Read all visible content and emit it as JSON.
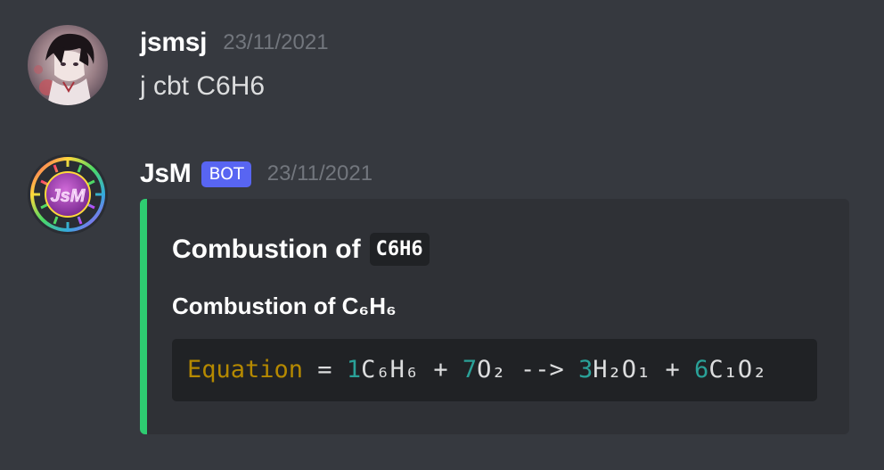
{
  "messages": [
    {
      "author": "jsmsj",
      "timestamp": "23/11/2021",
      "content": "j cbt C6H6"
    },
    {
      "author": "JsM",
      "bot_tag": "BOT",
      "timestamp": "23/11/2021",
      "avatar_text": "JsM",
      "embed": {
        "accent_color": "#2ecc71",
        "title_text": "Combustion of",
        "title_code": "C6H6",
        "field_name": "Combustion of C₆H₆",
        "equation": {
          "label": "Equation",
          "eq": " = ",
          "terms": [
            {
              "coef": "1",
              "formula": "C₆H₆"
            },
            {
              "coef": "7",
              "formula": "O₂"
            },
            {
              "coef": "3",
              "formula": "H₂O₁"
            },
            {
              "coef": "6",
              "formula": "C₁O₂"
            }
          ],
          "plus": " + ",
          "arrow": " --> "
        }
      }
    }
  ],
  "colors": {
    "background": "#36393f",
    "embed_bg": "#2f3136",
    "code_bg": "#202225",
    "bot_tag": "#5865f2",
    "keyword": "#b58900",
    "number": "#2aa198"
  },
  "icons": {
    "user_avatar": "anime-avatar",
    "bot_avatar": "jsm-logo-avatar"
  }
}
